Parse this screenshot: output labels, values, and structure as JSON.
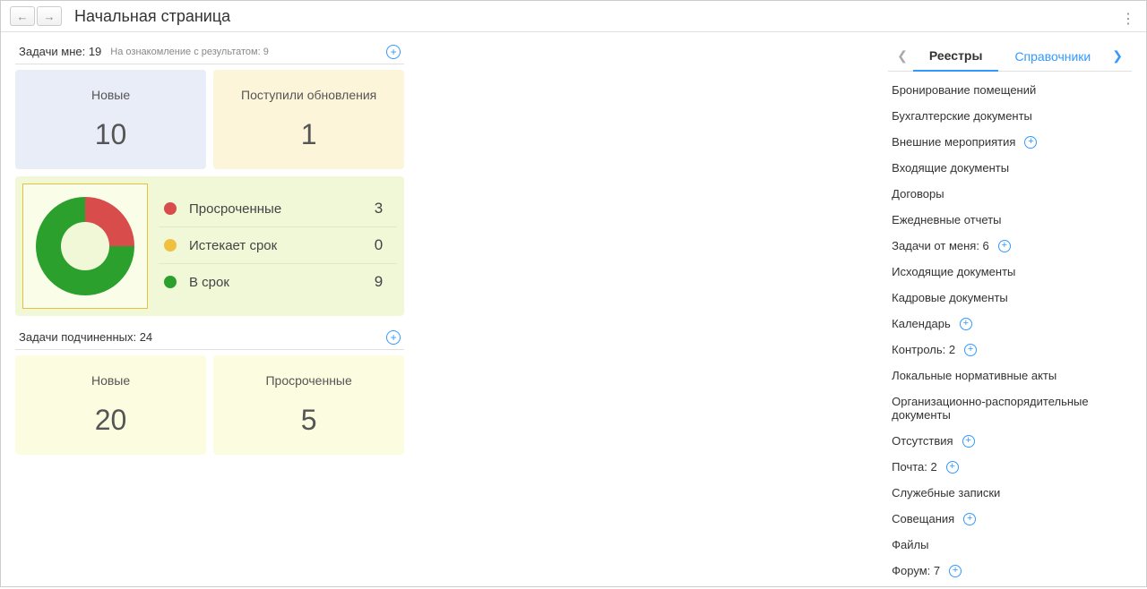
{
  "header": {
    "title": "Начальная страница"
  },
  "tasks_me": {
    "title": "Задачи мне: 19",
    "subtitle": "На ознакомление с результатом: 9",
    "cards": {
      "new": {
        "label": "Новые",
        "value": "10"
      },
      "updated": {
        "label": "Поступили обновления",
        "value": "1"
      }
    },
    "legend": {
      "overdue": {
        "label": "Просроченные",
        "value": "3"
      },
      "expiring": {
        "label": "Истекает срок",
        "value": "0"
      },
      "ontime": {
        "label": "В срок",
        "value": "9"
      }
    }
  },
  "tasks_sub": {
    "title": "Задачи подчиненных: 24",
    "cards": {
      "new": {
        "label": "Новые",
        "value": "20"
      },
      "overdue": {
        "label": "Просроченные",
        "value": "5"
      }
    }
  },
  "tabs": {
    "t1": "Реестры",
    "t2": "Справочники"
  },
  "registry": {
    "i0": "Бронирование помещений",
    "i1": "Бухгалтерские документы",
    "i2": "Внешние мероприятия",
    "i3": "Входящие документы",
    "i4": "Договоры",
    "i5": "Ежедневные отчеты",
    "i6": "Задачи от меня: 6",
    "i7": "Исходящие документы",
    "i8": "Кадровые документы",
    "i9": "Календарь",
    "i10": "Контроль: 2",
    "i11": "Локальные нормативные акты",
    "i12": "Организационно-распорядительные документы",
    "i13": "Отсутствия",
    "i14": "Почта: 2",
    "i15": "Служебные записки",
    "i16": "Совещания",
    "i17": "Файлы",
    "i18": "Форум: 7"
  },
  "chart_data": {
    "type": "pie",
    "title": "",
    "categories": [
      "Просроченные",
      "Истекает срок",
      "В срок"
    ],
    "values": [
      3,
      0,
      9
    ],
    "colors": [
      "#d84c4c",
      "#f0c040",
      "#2ca02c"
    ]
  }
}
